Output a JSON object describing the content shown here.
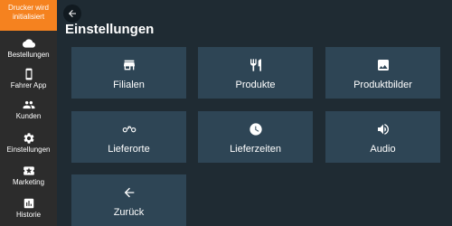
{
  "sidebar": {
    "printer_status": "Drucker wird initialisiert",
    "items": [
      {
        "label": "Bestellungen",
        "icon": "cloud-icon"
      },
      {
        "label": "Fahrer App",
        "icon": "phone-icon"
      },
      {
        "label": "Kunden",
        "icon": "people-icon"
      },
      {
        "label": "Einstellungen",
        "icon": "gear-icon"
      },
      {
        "label": "Marketing",
        "icon": "ticket-icon"
      },
      {
        "label": "Historie",
        "icon": "chart-icon"
      }
    ]
  },
  "main": {
    "title": "Einstellungen",
    "tiles": [
      {
        "label": "Filialen",
        "icon": "store-icon"
      },
      {
        "label": "Produkte",
        "icon": "cutlery-icon"
      },
      {
        "label": "Produktbilder",
        "icon": "image-icon"
      },
      {
        "label": "Lieferorte",
        "icon": "bike-icon"
      },
      {
        "label": "Lieferzeiten",
        "icon": "clock-icon"
      },
      {
        "label": "Audio",
        "icon": "speaker-icon"
      },
      {
        "label": "Zurück",
        "icon": "arrow-left-icon"
      }
    ]
  },
  "colors": {
    "accent": "#f5821f",
    "sidebar": "#2c2c2c",
    "background": "#1f2b33",
    "tile": "#2e4555"
  }
}
